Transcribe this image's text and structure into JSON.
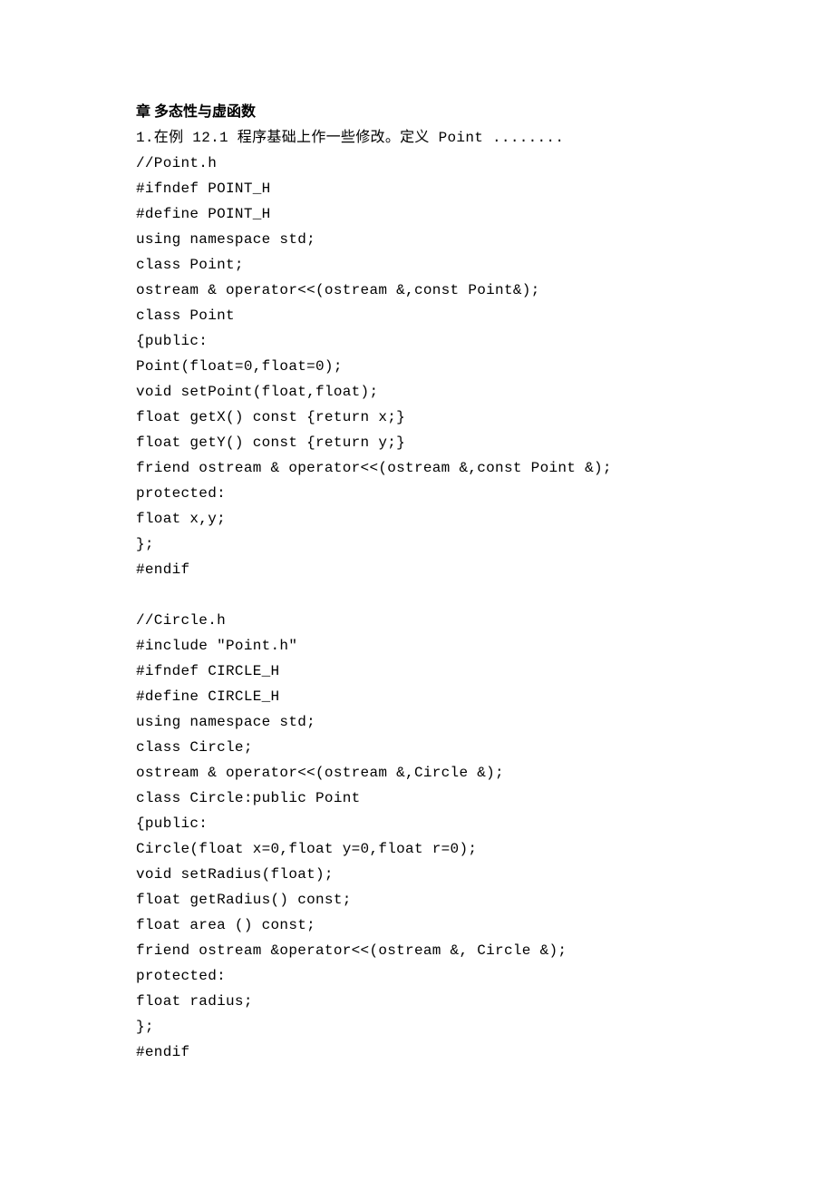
{
  "doc": {
    "heading": "章 多态性与虚函数",
    "intro": "1.在例 12.1 程序基础上作一些修改。定义 Point ........",
    "block1": [
      "//Point.h",
      "#ifndef POINT_H",
      "#define POINT_H",
      "using namespace std;",
      "class Point;",
      "ostream & operator<<(ostream &,const Point&);",
      "class Point",
      "{public:",
      "Point(float=0,float=0);",
      "void setPoint(float,float);",
      "float getX() const {return x;}",
      "float getY() const {return y;}",
      "friend ostream & operator<<(ostream &,const Point &);",
      "protected:",
      "float x,y;",
      "};",
      "#endif"
    ],
    "block2": [
      "//Circle.h",
      "#include \"Point.h\"",
      "#ifndef CIRCLE_H",
      "#define CIRCLE_H",
      "using namespace std;",
      "class Circle;",
      "ostream & operator<<(ostream &,Circle &);",
      "class Circle:public Point",
      "{public:",
      "Circle(float x=0,float y=0,float r=0);",
      "void setRadius(float);",
      "float getRadius() const;",
      "float area () const;",
      "friend ostream &operator<<(ostream &, Circle &);",
      "protected:",
      "float radius;",
      "};",
      "#endif"
    ]
  }
}
